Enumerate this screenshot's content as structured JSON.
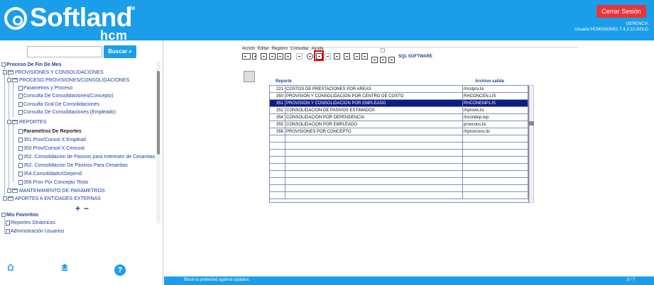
{
  "header": {
    "logo_text": "Softland",
    "logo_tm": "TM",
    "logo_sub": "hcm",
    "logout_label": "Cerrar Sesión",
    "user_role": "GERENCIA",
    "user_info": "Usuario:HCMGNOM01 7.4.2.12-GOLD"
  },
  "search": {
    "placeholder": "",
    "button_label": "Buscar"
  },
  "tree": {
    "root": "Proceso De Fin De Mes",
    "items": [
      "PROVISIONES Y CONSOLIDACIONES",
      "PROCESO PROVISIONES/CONSOLIDACIONES",
      "Parametros y Proceso",
      "Consulta De Consolidaciones(Concepto)",
      "Consulta Gral De Consolidaciones",
      "Consulta De Consolidaciones (Empleado)",
      "REPORTES",
      "Parametros De Reportes",
      "351.Prov/Consol X Emplead",
      "350.Prov/Consol X Cencost",
      "352. Consolidacion de Pasivos para Intereses de Cesantias",
      "352. Consolidacion De Pasivos Para Cesantias",
      "354.ConsolidadoXDepend.",
      "356.Prov Por Concepto Texto",
      "MANTENIMIENTO DE PARAMETROS",
      "APORTES A ENTIDADES EXTERNAS"
    ],
    "plus": "+",
    "minus": "−"
  },
  "favorites": {
    "title": "Mis Favoritos",
    "items": [
      "Reportes Dinámicos",
      "Administración Usuarios"
    ]
  },
  "menu": [
    "Acción",
    "Editar",
    "Registro",
    "Consultar",
    "Ayuda"
  ],
  "toolbar": {
    "label": "SQL SOFTWARE"
  },
  "grid": {
    "header_report": "Reporte",
    "header_file": "Archivo salida",
    "rows": [
      {
        "num": "221",
        "name": "COSTOS DE PRESTACIONES POR AREAS",
        "file": "rhcstprs.lis",
        "selected": false
      },
      {
        "num": "350",
        "name": "PROVISION Y CONSOLIDACION POR CENTRO DE COSTO",
        "file": "RHCONCEN.LIS",
        "selected": false
      },
      {
        "num": "351",
        "name": "PROVISION Y CONSOLIDACION POR EMPLEADO",
        "file": "RHCONEMP.LIS",
        "selected": true
      },
      {
        "num": "352",
        "name": "CONSOLIDACION DE PASIVOS ESTIMADOS",
        "file": "rhprovis.lis",
        "selected": false
      },
      {
        "num": "354",
        "name": "CONSOLIDACION POR DEPENDENCIA",
        "file": "rhcondep.rep",
        "selected": false
      },
      {
        "num": "355",
        "name": "CONSOLIDACION POR EMPLEADO",
        "file": "provcons.lis",
        "selected": false
      },
      {
        "num": "356",
        "name": "PROVISIONES POR CONCEPTO",
        "file": "rhprovcons.lis",
        "selected": false
      }
    ]
  },
  "status": {
    "message": "Block is protected against updates.",
    "page": "3 / 7"
  }
}
